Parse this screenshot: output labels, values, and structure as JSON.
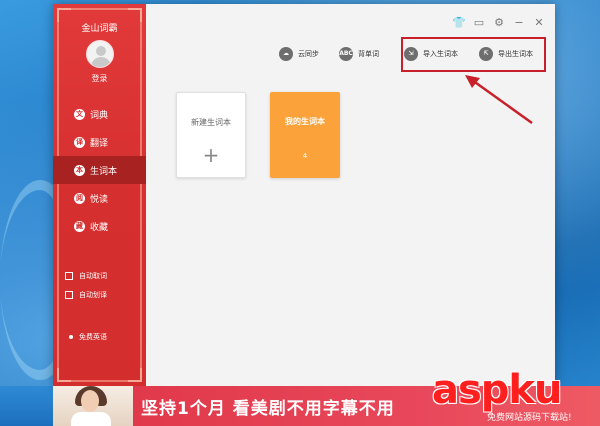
{
  "app": {
    "title": "金山词霸",
    "login_label": "登录"
  },
  "sidebar": {
    "items": [
      {
        "label": "词典",
        "icon": "dictionary-icon",
        "glyph": "文",
        "active": false
      },
      {
        "label": "翻译",
        "icon": "translate-icon",
        "glyph": "译",
        "active": false
      },
      {
        "label": "生词本",
        "icon": "wordbook-icon",
        "glyph": "本",
        "active": true
      },
      {
        "label": "悦读",
        "icon": "reading-icon",
        "glyph": "阅",
        "active": false
      },
      {
        "label": "收藏",
        "icon": "favorites-icon",
        "glyph": "藏",
        "active": false
      }
    ],
    "options": [
      {
        "label": "自动取词",
        "checked": false
      },
      {
        "label": "自动划译",
        "checked": false
      }
    ],
    "free_english": "免费英语"
  },
  "toolbar": {
    "cloud_sync": {
      "label": "云同步",
      "icon": "cloud-icon",
      "glyph": "☁"
    },
    "recite": {
      "label": "背单词",
      "icon": "abc-icon",
      "glyph": "ABC"
    },
    "import": {
      "label": "导入生词本",
      "icon": "import-icon",
      "glyph": "⇲"
    },
    "export": {
      "label": "导出生词本",
      "icon": "export-icon",
      "glyph": "⇱"
    }
  },
  "window_controls": {
    "skin": "👕",
    "message": "▭",
    "settings": "⚙",
    "minimize": "−",
    "close": "✕"
  },
  "wordbooks": {
    "new_label": "新建生词本",
    "new_plus": "+",
    "mine_label": "我的生词本",
    "mine_count": "4"
  },
  "banner": {
    "text": "坚持1个月  看美剧不用字幕不用"
  },
  "watermark": {
    "logo": "aspku",
    "sub": "免费网站源码下载站!"
  },
  "colors": {
    "sidebar_red": "#d32d2d",
    "active_red": "#a82222",
    "card_orange": "#fba33a",
    "annotation_red": "#c8202a"
  }
}
